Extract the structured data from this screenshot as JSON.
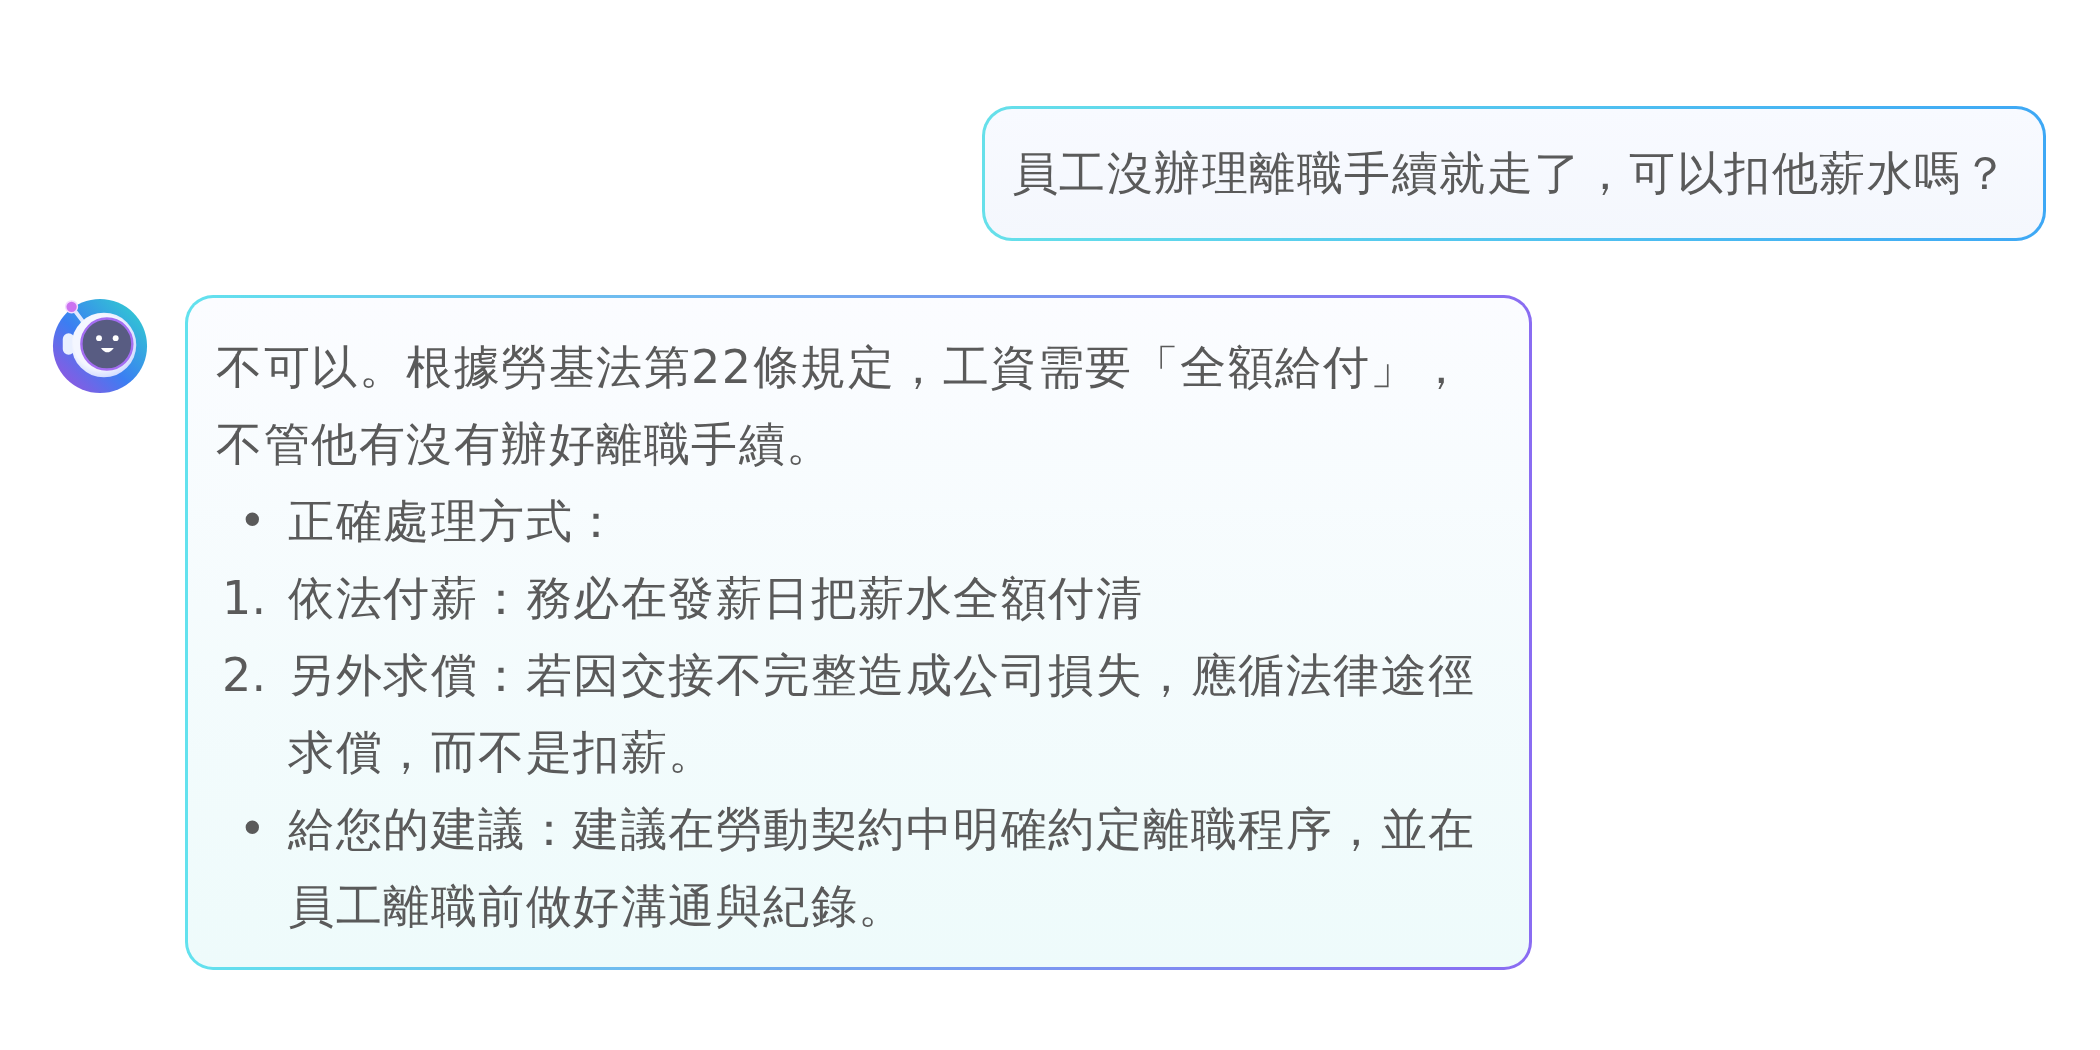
{
  "conversation": [
    {
      "kind": "user",
      "text": "員工沒辦理離職手續就走了，可以扣他薪水嗎？"
    },
    {
      "kind": "assistant",
      "paragraph": "不可以。根據勞基法第22條規定，工資需要「全額給付」，不管他有沒有辦好離職手續。",
      "items": [
        {
          "marker": "•",
          "text": "正確處理方式："
        },
        {
          "marker": "1.",
          "text": "依法付薪：務必在發薪日把薪水全額付清"
        },
        {
          "marker": "2.",
          "text": "另外求償：若因交接不完整造成公司損失，應循法律途徑求償，而不是扣薪。"
        },
        {
          "marker": "•",
          "text": "給您的建議：建議在勞動契約中明確約定離職程序，並在員工離職前做好溝通與紀錄。"
        }
      ]
    }
  ]
}
